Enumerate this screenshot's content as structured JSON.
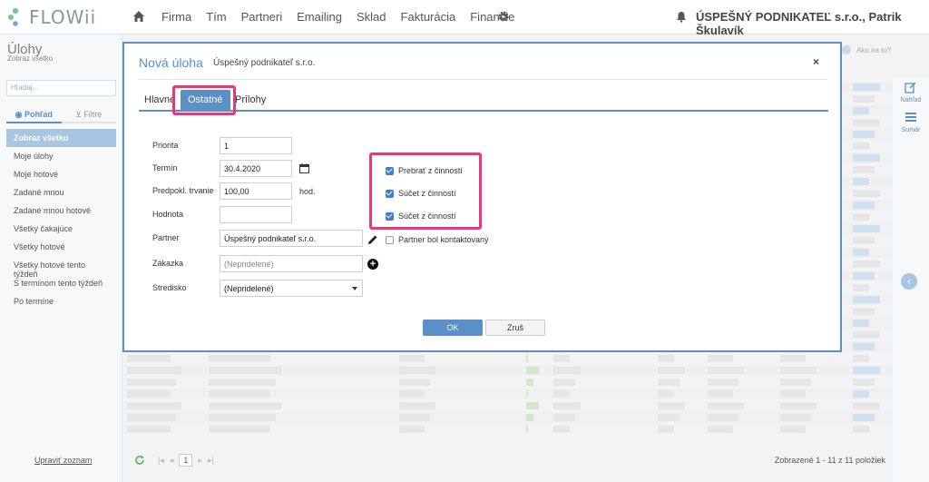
{
  "app": {
    "logo_text": "FLOWii",
    "nav": [
      "Firma",
      "Tím",
      "Partneri",
      "Emailing",
      "Sklad",
      "Fakturácia",
      "Financie"
    ],
    "company": "ÚSPEŠNÝ PODNIKATEĽ s.r.o., Patrik Škulavík",
    "brand_color": "#5a8fc8",
    "highlight_color": "#e8377a"
  },
  "sidebar": {
    "title": "Úlohy",
    "subtitle": "Zobraz všetko",
    "search_placeholder": "Hľadaj...",
    "tabs": [
      "Pohľad",
      "Filtre"
    ],
    "items": [
      "Zobraz všetko",
      "Moje úlohy",
      "Moje hotové",
      "Zadané mnou",
      "Zadané mnou hotové",
      "Všetky čakajúce",
      "Všetky hotové",
      "Všetky hotové tento týždeň",
      "S termínom tento týždeň",
      "Po termíne"
    ],
    "footer_link": "Upraviť zoznam"
  },
  "header_right": {
    "text": "Ako na to?"
  },
  "right_rail": {
    "items": [
      "Náhľad",
      "Sumár"
    ]
  },
  "footer": {
    "page": "1",
    "count_text": "Zobrazené 1 - 11 z 11 položiek"
  },
  "modal": {
    "title": "Nová úloha",
    "subtitle": "Úspešný podnikateľ s.r.o.",
    "close": "×",
    "tabs": [
      "Hlavné",
      "Ostatné",
      "Prílohy"
    ],
    "active_tab": "Ostatné",
    "fields": {
      "priorita_label": "Priorita",
      "priorita_value": "1",
      "termin_label": "Termín",
      "termin_value": "30.4.2020",
      "trvanie_label": "Predpokl. trvanie",
      "trvanie_value": "100,00",
      "trvanie_unit": "hod.",
      "hodnota_label": "Hodnota",
      "hodnota_value": "",
      "partner_label": "Partner",
      "partner_value": "Úspešný podnikateľ s.r.o.",
      "zakazka_label": "Zákazka",
      "zakazka_placeholder": "(Nepridelené)",
      "stredisko_label": "Stredisko",
      "stredisko_value": "(Nepridelené)"
    },
    "checkboxes": {
      "prebrat": "Prebrať z činností",
      "sucet1": "Súčet z činností",
      "sucet2": "Súčet z činností",
      "partner_kontakt": "Partner bol kontaktovaný"
    },
    "buttons": {
      "ok": "OK",
      "cancel": "Zruš"
    }
  }
}
